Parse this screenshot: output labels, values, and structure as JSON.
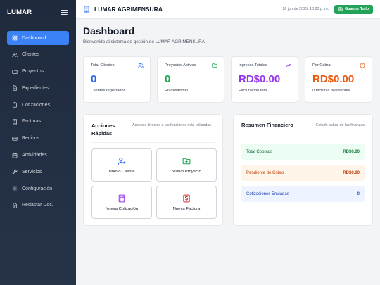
{
  "sidebar": {
    "brand": "LUMAR",
    "items": [
      {
        "label": "Dashboard",
        "icon": "grid-icon"
      },
      {
        "label": "Clientes",
        "icon": "users-icon"
      },
      {
        "label": "Proyectos",
        "icon": "folder-icon"
      },
      {
        "label": "Expedientes",
        "icon": "file-icon"
      },
      {
        "label": "Cotizaciones",
        "icon": "clipboard-icon"
      },
      {
        "label": "Facturas",
        "icon": "receipt-icon"
      },
      {
        "label": "Recibos",
        "icon": "card-icon"
      },
      {
        "label": "Actividades",
        "icon": "calendar-icon"
      },
      {
        "label": "Servicios",
        "icon": "wrench-icon"
      },
      {
        "label": "Configuración",
        "icon": "gear-icon"
      },
      {
        "label": "Redactar Doc.",
        "icon": "document-icon"
      }
    ]
  },
  "topbar": {
    "title": "LUMAR AGRIMENSURA",
    "date": "26 jun de 2025, 10:23 p. m.",
    "save_label": "Guardar Todo"
  },
  "header": {
    "title": "Dashboard",
    "subtitle": "Bienvenido al sistema de gestión de LUMAR AGRIMENSURA"
  },
  "stats": [
    {
      "label": "Total Clientes",
      "value": "0",
      "desc": "Clientes registrados",
      "color": "#2563eb",
      "icon": "users-icon"
    },
    {
      "label": "Proyectos Activos",
      "value": "0",
      "desc": "En desarrollo",
      "color": "#16a34a",
      "icon": "folder-icon"
    },
    {
      "label": "Ingresos Totales",
      "value": "RD$0.00",
      "desc": "Facturación total",
      "color": "#9333ea",
      "icon": "trending-up-icon"
    },
    {
      "label": "Por Cobrar",
      "value": "RD$0.00",
      "desc": "0 facturas pendientes",
      "color": "#ea580c",
      "icon": "alert-circle-icon"
    }
  ],
  "quick_actions": {
    "title": "Acciones Rápidas",
    "subtitle": "Accesos directos a las funciones más utilizadas",
    "items": [
      {
        "label": "Nuevo Cliente",
        "icon": "user-plus-icon",
        "color": "#2563eb"
      },
      {
        "label": "Nuevo Proyecto",
        "icon": "folder-plus-icon",
        "color": "#16a34a"
      },
      {
        "label": "Nueva Cotización",
        "icon": "calculator-icon",
        "color": "#9333ea"
      },
      {
        "label": "Nueva Factura",
        "icon": "dollar-icon",
        "color": "#dc2626"
      }
    ]
  },
  "financial": {
    "title": "Resumen Financiero",
    "subtitle": "Estado actual de las finanzas",
    "rows": [
      {
        "label": "Total Cobrado",
        "value": "RD$0.00",
        "bg": "#ecfdf3",
        "text": "#166534",
        "val": "#15803d"
      },
      {
        "label": "Pendiente de Cobro",
        "value": "RD$0.00",
        "bg": "#fff4e8",
        "text": "#c2410c",
        "val": "#c2410c"
      },
      {
        "label": "Cotizaciones Enviadas",
        "value": "0",
        "bg": "#eef4ff",
        "text": "#1e40af",
        "val": "#1d4ed8"
      }
    ]
  }
}
